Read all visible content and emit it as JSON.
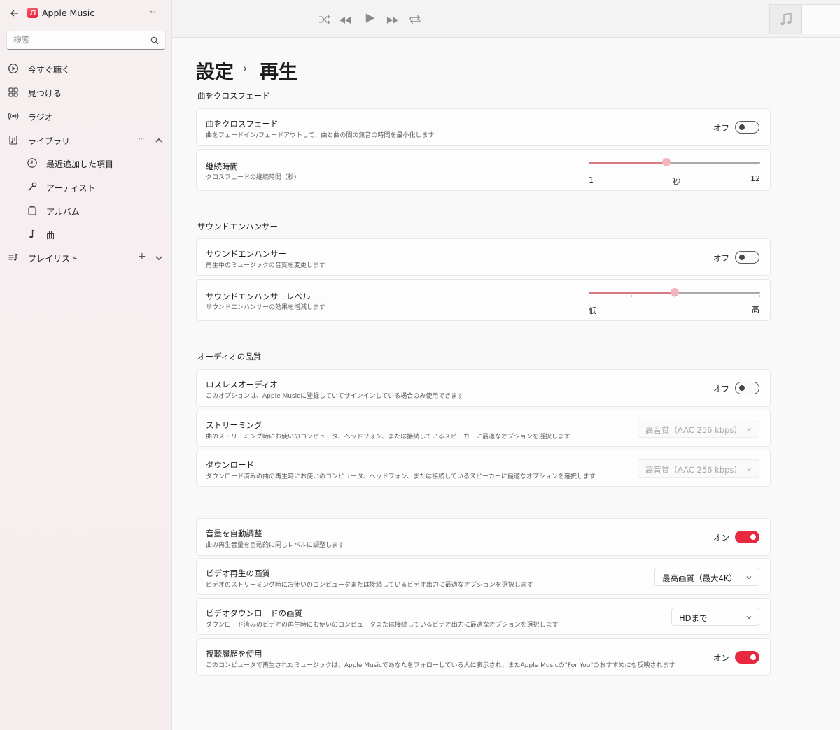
{
  "app": {
    "title": "Apple Music",
    "more_label": "···"
  },
  "search": {
    "placeholder": "検索"
  },
  "sidebar": {
    "items": [
      {
        "label": "今すぐ聴く",
        "icon": "play-circle-icon"
      },
      {
        "label": "見つける",
        "icon": "grid-icon"
      },
      {
        "label": "ラジオ",
        "icon": "radio-icon"
      },
      {
        "label": "ライブラリ",
        "icon": "library-icon"
      },
      {
        "label": "最近追加した項目",
        "icon": "clock-icon"
      },
      {
        "label": "アーティスト",
        "icon": "microphone-icon"
      },
      {
        "label": "アルバム",
        "icon": "album-icon"
      },
      {
        "label": "曲",
        "icon": "note-icon"
      },
      {
        "label": "プレイリスト",
        "icon": "playlist-icon"
      }
    ],
    "library_more": "···",
    "playlist_add": "+"
  },
  "page": {
    "crumb_parent": "設定",
    "crumb_sep": "›",
    "crumb_current": "再生"
  },
  "sections": {
    "crossfade": {
      "heading": "曲をクロスフェード",
      "toggle": {
        "title": "曲をクロスフェード",
        "subtitle": "曲をフェードイン/フェードアウトして、曲と曲の間の無音の時間を最小化します",
        "state": "オフ",
        "on": false
      },
      "duration": {
        "title": "継続時間",
        "subtitle": "クロスフェードの継続時間（秒）",
        "min_label": "1",
        "unit_label": "秒",
        "max_label": "12",
        "min": 1,
        "max": 12,
        "value": 6
      }
    },
    "enhancer": {
      "heading": "サウンドエンハンサー",
      "toggle": {
        "title": "サウンドエンハンサー",
        "subtitle": "再生中のミュージックの音質を変更します",
        "state": "オフ",
        "on": false
      },
      "level": {
        "title": "サウンドエンハンサーレベル",
        "subtitle": "サウンドエンハンサーの効果を増減します",
        "min_label": "低",
        "max_label": "高",
        "fraction": 0.5
      }
    },
    "audio": {
      "heading": "オーディオの品質",
      "lossless": {
        "title": "ロスレスオーディオ",
        "subtitle": "このオプションは、Apple Musicに登録していてサインインしている場合のみ使用できます",
        "state": "オフ",
        "on": false
      },
      "streaming": {
        "title": "ストリーミング",
        "subtitle": "曲のストリーミング時にお使いのコンピュータ、ヘッドフォン、または接続しているスピーカーに最適なオプションを選択します",
        "value": "高音質（AAC 256 kbps）"
      },
      "download": {
        "title": "ダウンロード",
        "subtitle": "ダウンロード済みの曲の再生時にお使いのコンピュータ、ヘッドフォン、または接続しているスピーカーに最適なオプションを選択します",
        "value": "高音質（AAC 256 kbps）"
      }
    },
    "other": {
      "volume": {
        "title": "音量を自動調整",
        "subtitle": "曲の再生音量を自動的に同じレベルに調整します",
        "state": "オン",
        "on": true
      },
      "video_quality": {
        "title": "ビデオ再生の画質",
        "subtitle": "ビデオのストリーミング時にお使いのコンピュータまたは接続しているビデオ出力に最適なオプションを選択します",
        "value": "最高画質（最大4K）"
      },
      "video_download": {
        "title": "ビデオダウンロードの画質",
        "subtitle": "ダウンロード済みのビデオの再生時にお使いのコンピュータまたは接続しているビデオ出力に最適なオプションを選択します",
        "value": "HDまで"
      },
      "history": {
        "title": "視聴履歴を使用",
        "subtitle": "このコンピュータで再生されたミュージックは、Apple Musicであなたをフォローしている人に表示され、またApple Musicの\"For You\"のおすすめにも反映されます",
        "state": "オン",
        "on": true
      }
    }
  },
  "colors": {
    "accent": "#e8283e",
    "slider_fill": "#d47c86",
    "slider_thumb": "#f2b3bb"
  }
}
